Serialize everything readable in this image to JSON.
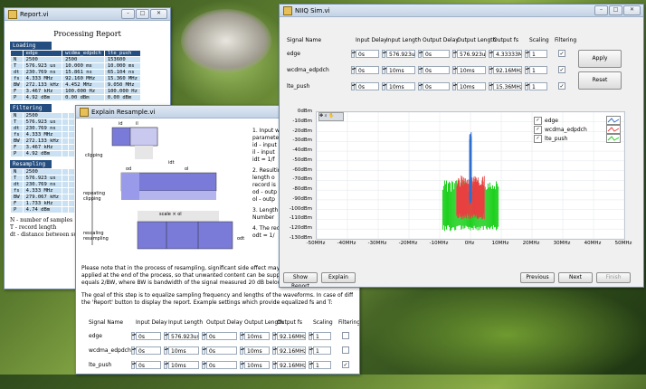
{
  "report_window": {
    "title": "Report.vi",
    "heading": "Processing Report",
    "loading_label": "Loading",
    "filtering_label": "Filtering",
    "resampling_label": "Resampling",
    "columns": [
      "",
      "edge",
      "wcdma_edpdch",
      "lte_push"
    ],
    "loading_rows": [
      [
        "N",
        "2500",
        "2500",
        "153600"
      ],
      [
        "T",
        "576.923 us",
        "10.000 ms",
        "10.000 ms"
      ],
      [
        "dt",
        "230.769 ns",
        "15.861 ns",
        "65.104 ns"
      ],
      [
        "fs",
        "4.333 MHz",
        "92.160 MHz",
        "15.360 MHz"
      ],
      [
        "BW",
        "272.133 kHz",
        "4.452 MHz",
        "9.050 MHz"
      ],
      [
        "F",
        "3.467 kHz",
        "100.000 Hz",
        "100.000 Hz"
      ],
      [
        "P",
        "4.92 dBm",
        "0.00 dBm",
        "0.00 dBm"
      ]
    ],
    "filtering_rows": [
      [
        "N",
        "2500",
        "",
        ""
      ],
      [
        "T",
        "576.923 us",
        "",
        ""
      ],
      [
        "dt",
        "230.769 ns",
        "",
        ""
      ],
      [
        "fs",
        "4.333 MHz",
        "",
        ""
      ],
      [
        "BW",
        "272.133 kHz",
        "",
        ""
      ],
      [
        "F",
        "3.467 kHz",
        "",
        ""
      ],
      [
        "P",
        "4.92 dBm",
        "",
        ""
      ]
    ],
    "resampling_rows": [
      [
        "N",
        "2500",
        "",
        ""
      ],
      [
        "T",
        "576.923 us",
        "",
        ""
      ],
      [
        "dt",
        "230.769 ns",
        "",
        ""
      ],
      [
        "fs",
        "4.333 MHz",
        "",
        ""
      ],
      [
        "BW",
        "279.067 kHz",
        "",
        ""
      ],
      [
        "F",
        "1.733 kHz",
        "",
        ""
      ],
      [
        "P",
        "4.74 dBm",
        "",
        ""
      ]
    ],
    "notes": [
      "N - number of samples",
      "T - record length",
      "dt - distance between sul"
    ]
  },
  "explain_window": {
    "title": "Explain Resample.vi",
    "diagram": {
      "clipping": "clipping",
      "repeating_clipping": "repeating clipping",
      "rescaling_resampling": "rescaling resampling",
      "scale_ol": "scale × ol",
      "id": "id",
      "il": "il",
      "idt": "idt",
      "od": "od",
      "ol": "ol",
      "odt": "odt"
    },
    "side_notes": [
      "1. Input wa",
      "parameter",
      "id - input",
      "il - input",
      "idt = 1/f",
      "2. Resulting",
      "length o",
      "record is",
      "od - outp",
      "ol - outp",
      "3. Length re",
      "Number",
      "4. The reco",
      "odt = 1/"
    ],
    "paragraph1": [
      "Please note that in the process of resampling, significant side effect may distrust the s",
      "applied at the end of the process, so that unwanted content can be suppressed. LPF",
      "equals 2/BW, where BW is bandwidth of the signal measured 20 dB below the highe"
    ],
    "paragraph2": [
      "The goal of this step is to equalize sampling frequency and lengths of the waveforms. In case of difficulties please use",
      "the 'Report' button to display the report. Example settings which provide equalized fs and T:"
    ],
    "table": {
      "headers": [
        "Signal Name",
        "Input Delay",
        "Input Length",
        "Output Delay",
        "Output Length",
        "Output fs",
        "Scaling",
        "Filtering"
      ],
      "rows": [
        {
          "name": "edge",
          "input_delay": "0s",
          "input_length": "576.923us",
          "output_delay": "0s",
          "output_length": "10ms",
          "output_fs": "92.16MHz",
          "scaling": "1",
          "filtering": ""
        },
        {
          "name": "wcdma_edpdch",
          "input_delay": "0s",
          "input_length": "10ms",
          "output_delay": "0s",
          "output_length": "10ms",
          "output_fs": "92.16MHz",
          "scaling": "1",
          "filtering": ""
        },
        {
          "name": "lte_push",
          "input_delay": "0s",
          "input_length": "10ms",
          "output_delay": "0s",
          "output_length": "10ms",
          "output_fs": "92.16MHz",
          "scaling": "1",
          "filtering": "✓"
        }
      ]
    }
  },
  "main_window": {
    "title": "NIIQ Sim.vi",
    "table": {
      "headers": [
        "Signal Name",
        "Input Delay",
        "Input Length",
        "Output Delay",
        "Output Length",
        "Output fs",
        "Scaling",
        "Filtering"
      ],
      "rows": [
        {
          "name": "edge",
          "input_delay": "0s",
          "input_length": "576.923us",
          "output_delay": "0s",
          "output_length": "576.923us",
          "output_fs": "4.33333MHz",
          "scaling": "1",
          "filtering": "✓"
        },
        {
          "name": "wcdma_edpdch",
          "input_delay": "0s",
          "input_length": "10ms",
          "output_delay": "0s",
          "output_length": "10ms",
          "output_fs": "92.16MHz",
          "scaling": "1",
          "filtering": "✓"
        },
        {
          "name": "lte_push",
          "input_delay": "0s",
          "input_length": "10ms",
          "output_delay": "0s",
          "output_length": "10ms",
          "output_fs": "15.36MHz",
          "scaling": "1",
          "filtering": "✓"
        }
      ]
    },
    "apply_label": "Apply",
    "reset_label": "Reset",
    "show_report_label": "Show Report",
    "explain_label": "Explain",
    "previous_label": "Previous",
    "next_label": "Next",
    "finish_label": "Finish",
    "legend": [
      {
        "name": "edge",
        "color": "#2f6fd0"
      },
      {
        "name": "wcdma_edpdch",
        "color": "#e84040"
      },
      {
        "name": "lte_push",
        "color": "#20d020"
      }
    ]
  },
  "chart_data": {
    "type": "line",
    "title": "",
    "xlabel": "",
    "ylabel": "",
    "x_ticks": [
      "-50MHz",
      "-40MHz",
      "-30MHz",
      "-20MHz",
      "-10MHz",
      "0Hz",
      "10MHz",
      "20MHz",
      "30MHz",
      "40MHz",
      "50MHz"
    ],
    "y_ticks": [
      "0dBm",
      "-10dBm",
      "-20dBm",
      "-30dBm",
      "-40dBm",
      "-50dBm",
      "-60dBm",
      "-70dBm",
      "-80dBm",
      "-90dBm",
      "-100dBm",
      "-110dBm",
      "-120dBm",
      "-130dBm"
    ],
    "xlim": [
      -50,
      50
    ],
    "ylim": [
      -130,
      0
    ],
    "grid": true,
    "legend_position": "top-right",
    "series": [
      {
        "name": "edge",
        "color": "#2f6fd0",
        "band_mhz": [
          -0.3,
          0.3
        ],
        "peak_dbm": -20,
        "floor_dbm": -95
      },
      {
        "name": "wcdma_edpdch",
        "color": "#e84040",
        "band_mhz": [
          -4.5,
          4.5
        ],
        "peak_dbm": -65,
        "floor_dbm": -110
      },
      {
        "name": "lte_push",
        "color": "#20d020",
        "band_mhz": [
          -9,
          9
        ],
        "peak_dbm": -70,
        "floor_dbm": -122
      }
    ]
  }
}
